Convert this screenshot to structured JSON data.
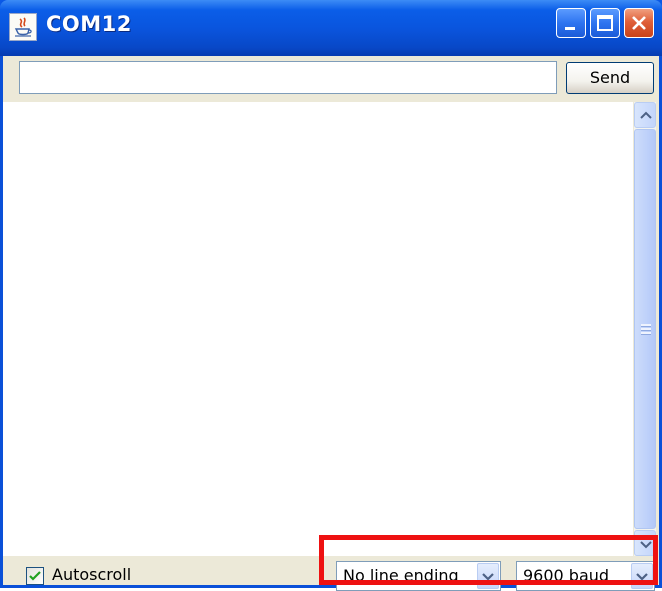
{
  "window": {
    "title": "COM12",
    "icon": "java-icon",
    "controls": [
      "minimize-icon",
      "maximize-icon",
      "close-icon"
    ]
  },
  "input": {
    "value": "",
    "placeholder": ""
  },
  "toolbar": {
    "send_label": "Send"
  },
  "output": {
    "text": ""
  },
  "footer": {
    "autoscroll_label": "Autoscroll",
    "autoscroll_checked": true,
    "line_ending": "No line ending",
    "baud_rate": "9600 baud"
  },
  "colors": {
    "titlebar": "#0a55de",
    "client": "#ece9d8",
    "highlight": "#ee1111"
  }
}
